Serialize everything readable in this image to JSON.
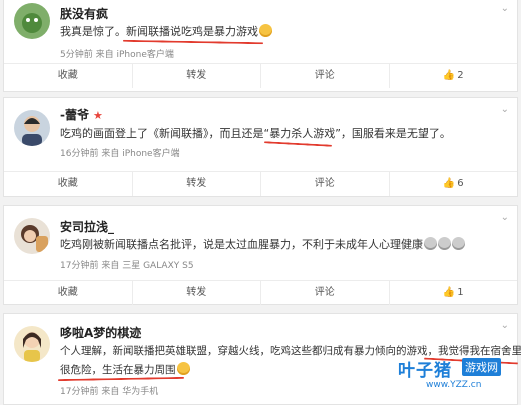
{
  "posts": [
    {
      "username": "朕没有疯",
      "text_before": "我真是惊了。",
      "text_highlight": "新闻联播说吃鸡是暴力游戏",
      "text_after": "",
      "time": "5分钟前",
      "source_prefix": "来自",
      "source": "iPhone客户端",
      "actions": {
        "favorite": "收藏",
        "repost": "转发",
        "comment": "评论",
        "like": "2"
      }
    },
    {
      "username": "-蕾爷",
      "text_before": "吃鸡的画面登上了《新闻联播》，而且还是",
      "text_highlight": "“暴力杀人游戏”",
      "text_after": "，国服看来是无望了。",
      "time": "16分钟前",
      "source_prefix": "来自",
      "source": "iPhone客户端",
      "actions": {
        "favorite": "收藏",
        "repost": "转发",
        "comment": "评论",
        "like": "6"
      }
    },
    {
      "username": "安司拉浅_",
      "text_before": "吃鸡刚被新闻联播点名批评，说是太过血腥暴力，不利于未成年人心理健康",
      "text_highlight": "",
      "text_after": "",
      "time": "17分钟前",
      "source_prefix": "来自",
      "source": "三星 GALAXY S5",
      "actions": {
        "favorite": "收藏",
        "repost": "转发",
        "comment": "评论",
        "like": "1"
      }
    },
    {
      "username": "哆啦A梦的棋迹",
      "text_line1": "个人理解，新闻联播把英雄联盟，穿越火线，吃鸡这些都归成有暴力倾向的游戏，",
      "text_line1_highlight": "我觉得我在宿舍里",
      "text_line2_highlight": "很危险，生活在暴力周围",
      "time": "17分钟前",
      "source_prefix": "来自",
      "source": "华为手机"
    }
  ],
  "watermark": {
    "brand": "叶子猪",
    "tag": "游戏网",
    "url": "www.YZZ.cn"
  },
  "colors": {
    "underline": "#e23b2e",
    "brand": "#1e7fd8"
  }
}
